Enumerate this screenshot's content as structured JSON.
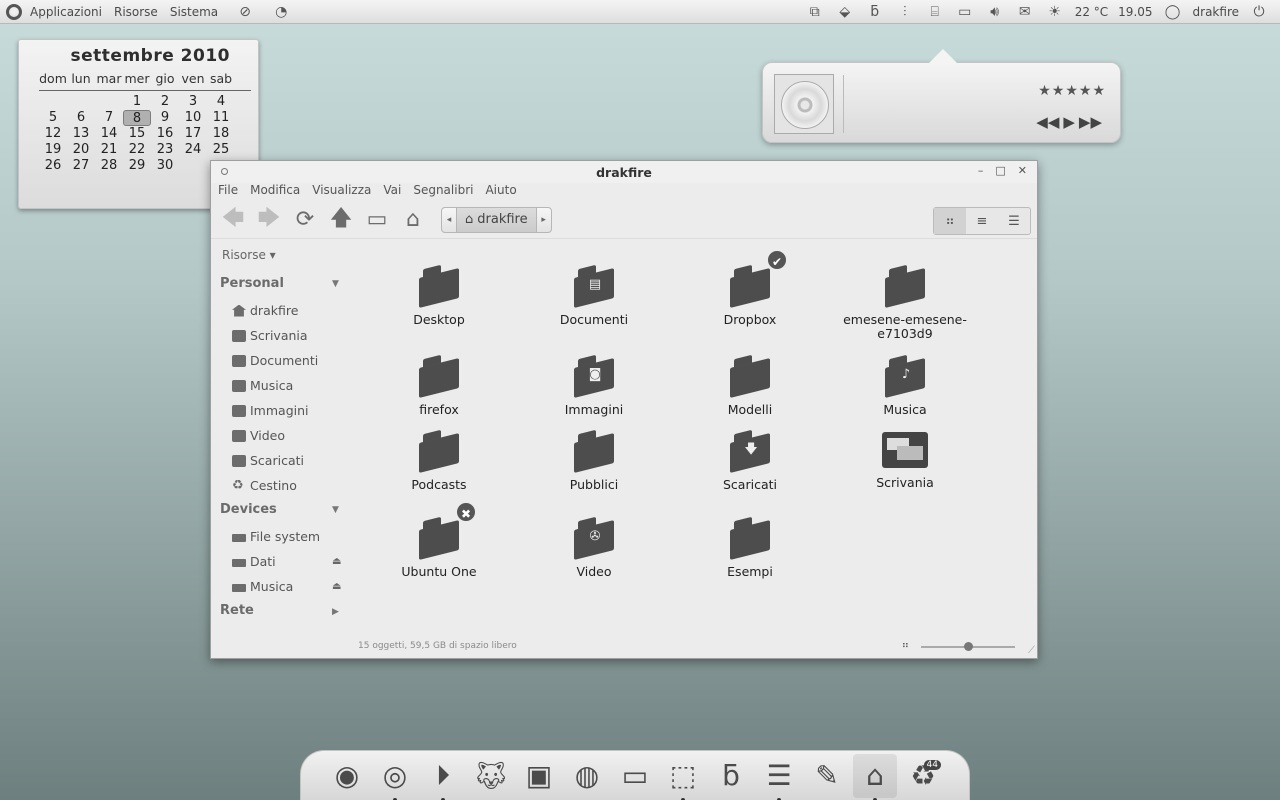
{
  "top_panel": {
    "menus": [
      "Applicazioni",
      "Risorse",
      "Sistema"
    ],
    "temperature": "22 °C",
    "clock": "19.05",
    "user": "drakfire"
  },
  "calendar": {
    "title": "settembre 2010",
    "weekdays": [
      "dom",
      "lun",
      "mar",
      "mer",
      "gio",
      "ven",
      "sab"
    ],
    "weeks": [
      [
        "",
        "",
        "",
        "1",
        "2",
        "3",
        "4"
      ],
      [
        "5",
        "6",
        "7",
        "8",
        "9",
        "10",
        "11"
      ],
      [
        "12",
        "13",
        "14",
        "15",
        "16",
        "17",
        "18"
      ],
      [
        "19",
        "20",
        "21",
        "22",
        "23",
        "24",
        "25"
      ],
      [
        "26",
        "27",
        "28",
        "29",
        "30",
        "",
        ""
      ]
    ],
    "today": "8"
  },
  "music": {
    "rating_stars": "★★★★★",
    "prev": "◀◀",
    "play": "▶",
    "next": "▶▶"
  },
  "window": {
    "title": "drakfire",
    "menu": [
      "File",
      "Modifica",
      "Visualizza",
      "Vai",
      "Segnalibri",
      "Aiuto"
    ],
    "path": "drakfire",
    "sidebar": {
      "combo": "Risorse ▾",
      "personal_header": "Personal",
      "personal_items": [
        "drakfire",
        "Scrivania",
        "Documenti",
        "Musica",
        "Immagini",
        "Video",
        "Scaricati",
        "Cestino"
      ],
      "devices_header": "Devices",
      "device_items": [
        "File system",
        "Dati",
        "Musica"
      ],
      "network_header": "Rete"
    },
    "items": [
      {
        "label": "Desktop"
      },
      {
        "label": "Documenti"
      },
      {
        "label": "Dropbox"
      },
      {
        "label": "emesene-emesene-e7103d9"
      },
      {
        "label": "firefox"
      },
      {
        "label": "Immagini"
      },
      {
        "label": "Modelli"
      },
      {
        "label": "Musica"
      },
      {
        "label": "Podcasts"
      },
      {
        "label": "Pubblici"
      },
      {
        "label": "Scaricati"
      },
      {
        "label": "Scrivania"
      },
      {
        "label": "Ubuntu One"
      },
      {
        "label": "Video"
      },
      {
        "label": "Esempi"
      }
    ],
    "status": "15 oggetti, 59,5 GB di spazio libero"
  },
  "dock": {
    "trash_count": "44"
  }
}
